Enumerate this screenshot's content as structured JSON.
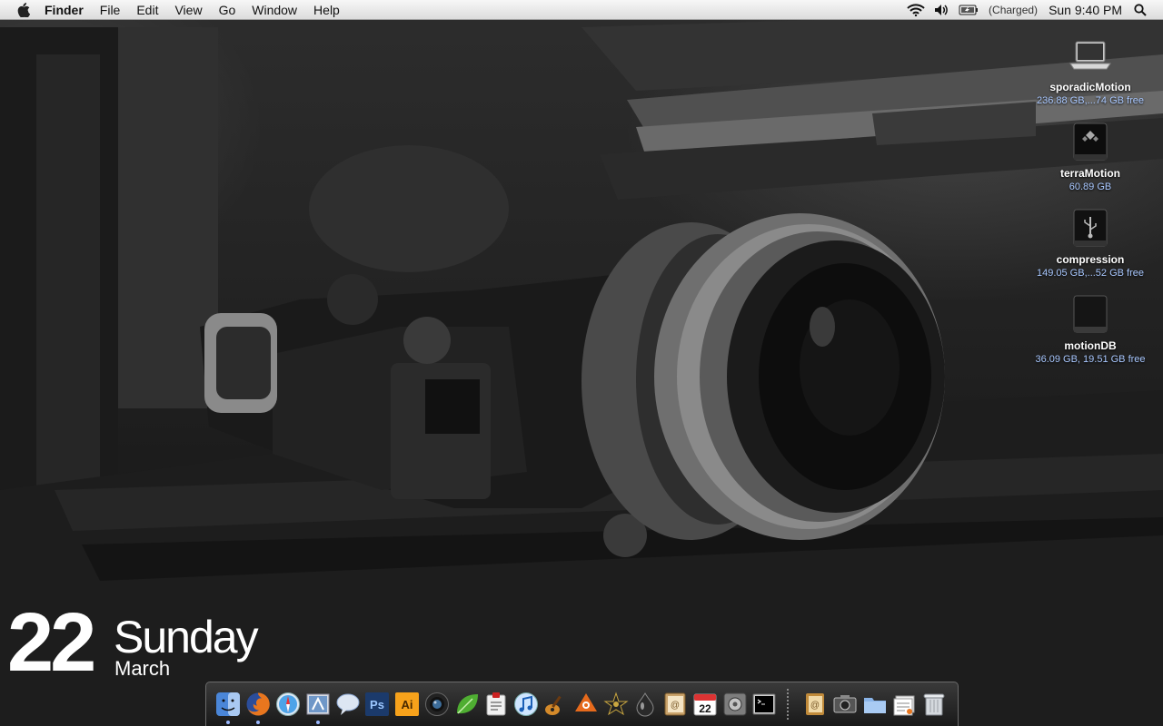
{
  "menubar": {
    "app_name": "Finder",
    "menus": [
      "File",
      "Edit",
      "View",
      "Go",
      "Window",
      "Help"
    ],
    "battery_status": "(Charged)",
    "clock": "Sun 9:40 PM"
  },
  "drives": [
    {
      "name": "sporadicMotion",
      "info": "236.88 GB,...74 GB free",
      "icon": "laptop-icon"
    },
    {
      "name": "terraMotion",
      "info": "60.89 GB",
      "icon": "external-drive-icon"
    },
    {
      "name": "compression",
      "info": "149.05 GB,...52 GB free",
      "icon": "usb-drive-icon"
    },
    {
      "name": "motionDB",
      "info": "36.09 GB, 19.51 GB free",
      "icon": "hard-drive-icon"
    }
  ],
  "date_widget": {
    "day": "22",
    "weekday": "Sunday",
    "month": "March"
  },
  "dock": {
    "items": [
      {
        "icon": "finder-icon",
        "running": true
      },
      {
        "icon": "firefox-icon",
        "running": true
      },
      {
        "icon": "safari-icon",
        "running": false
      },
      {
        "icon": "mail-icon",
        "running": true
      },
      {
        "icon": "ichat-icon",
        "running": false
      },
      {
        "icon": "photoshop-icon",
        "running": false,
        "label": "Ps"
      },
      {
        "icon": "illustrator-icon",
        "running": false,
        "label": "Ai"
      },
      {
        "icon": "aperture-icon",
        "running": false
      },
      {
        "icon": "leaf-icon",
        "running": false
      },
      {
        "icon": "script-icon",
        "running": false
      },
      {
        "icon": "itunes-icon",
        "running": false
      },
      {
        "icon": "garageband-icon",
        "running": false
      },
      {
        "icon": "reason-icon",
        "running": false
      },
      {
        "icon": "imovie-icon",
        "running": false
      },
      {
        "icon": "fluid-icon",
        "running": false
      },
      {
        "icon": "address-book-icon",
        "running": false
      },
      {
        "icon": "ical-icon",
        "running": false,
        "label": "22"
      },
      {
        "icon": "system-preferences-icon",
        "running": false
      },
      {
        "icon": "terminal-icon",
        "running": false
      }
    ],
    "stacks": [
      {
        "icon": "address-book-stack-icon"
      },
      {
        "icon": "screenshot-folder-icon"
      },
      {
        "icon": "folder-icon"
      },
      {
        "icon": "documents-stack-icon"
      },
      {
        "icon": "trash-icon"
      }
    ]
  }
}
